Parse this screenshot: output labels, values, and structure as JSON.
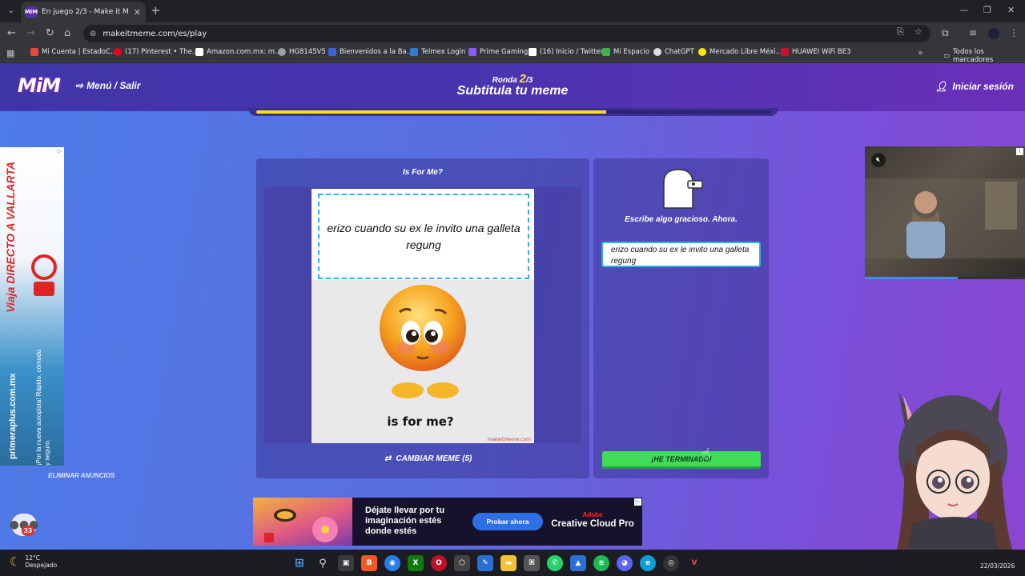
{
  "browser": {
    "tab_title": "En juego 2/3 - Make it Meme",
    "tab_favicon": "MiM",
    "url": "makeitmeme.com/es/play",
    "bookmarks": [
      {
        "label": "Mi Cuenta | EstadoC...",
        "color": "#e8453c"
      },
      {
        "label": "(17) Pinterest • The...",
        "color": "#e60023"
      },
      {
        "label": "Amazon.com.mx: m...",
        "color": "#ffffff"
      },
      {
        "label": "HG8145V5",
        "color": "#9aa0a6"
      },
      {
        "label": "Bienvenidos a la Ba...",
        "color": "#3c64d8"
      },
      {
        "label": "Telmex Login",
        "color": "#2a7fd4"
      },
      {
        "label": "Prime Gaming",
        "color": "#8a5cf5"
      },
      {
        "label": "(16) Inicio / Twitter",
        "color": "#ffffff"
      },
      {
        "label": "Mi Espacio",
        "color": "#3bb54a"
      },
      {
        "label": "ChatGPT",
        "color": "#dddddd"
      },
      {
        "label": "Mercado Libre Méxi...",
        "color": "#ffe600"
      },
      {
        "label": "HUAWEI WiFi BE3",
        "color": "#c8102e"
      }
    ],
    "all_bookmarks": "Todos los marcadores"
  },
  "site": {
    "logo": "MiM",
    "menu_label": "Menú / Salir",
    "round_word": "Ronda",
    "round_current": "2",
    "round_total": "/3",
    "title": "Subtitula tu meme",
    "login_label": "Iniciar sesión",
    "round_progress": 0.68
  },
  "game": {
    "meme_name": "Is For Me?",
    "caption": "erizo cuando su ex le invito una galleta regung",
    "meme_bottom_text": "is for me?",
    "watermark": "makeitmeme.com",
    "change_meme": "CAMBIAR MEME (5)",
    "prompt": "Escribe algo gracioso. Ahora.",
    "input_value": "erizo cuando su ex le invito una galleta regung",
    "done_button": "¡HE TERMINADO!"
  },
  "ads": {
    "left_headline": "Viaja DIRECTO A VALLARTA",
    "left_url": "primeraplus.com.mx",
    "left_sub": "¡Por la nueva autopista! Rápido, cómodo y seguro.",
    "remove_ads": "ELIMINAR ANUNCIOS",
    "video_progress": 0.58,
    "bottom_text": "Déjate llevar por tu imaginación estés donde estés",
    "bottom_cta": "Probar ahora",
    "bottom_brand_top": "Adobe",
    "bottom_brand": "Creative Cloud Pro"
  },
  "chat_badge": "33",
  "taskbar": {
    "temp": "12°C",
    "condition": "Despejado",
    "date": "22/03/2026"
  }
}
